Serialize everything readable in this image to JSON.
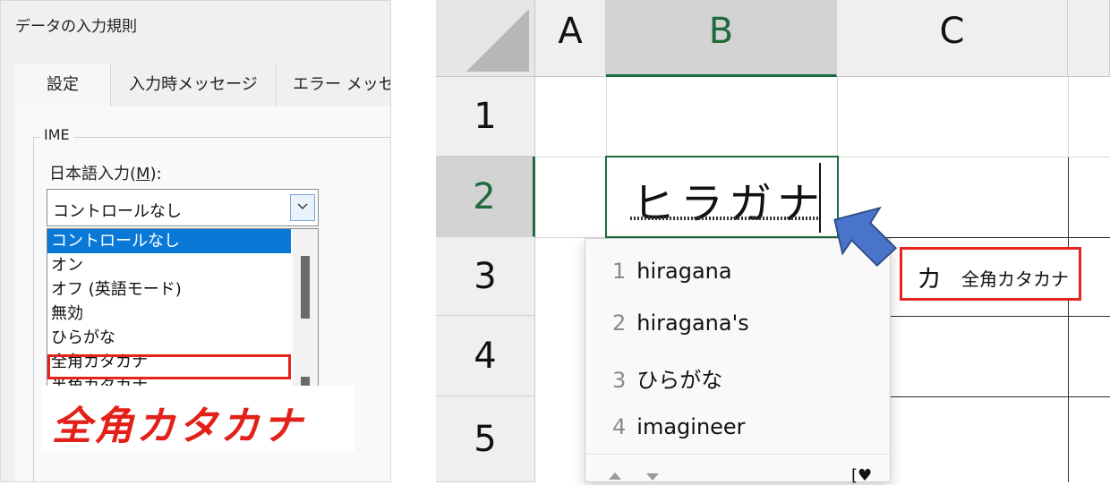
{
  "dialog": {
    "title": "データの入力規則",
    "tabs": [
      "設定",
      "入力時メッセージ",
      "エラー メッセー"
    ],
    "ime_group_label": "IME",
    "jp_input_label_prefix": "日本語入力(",
    "jp_input_label_key": "M",
    "jp_input_label_suffix": "):",
    "select_value": "コントロールなし",
    "options": [
      "コントロールなし",
      "オン",
      "オフ (英語モード)",
      "無効",
      "ひらがな",
      "全角カタカナ",
      "半角カタカナ"
    ],
    "selected_option_index": 0,
    "highlighted_option": "全角カタカナ",
    "big_label": "全角カタカナ"
  },
  "sheet": {
    "columns": [
      "A",
      "B",
      "C"
    ],
    "rows": [
      "1",
      "2",
      "3",
      "4",
      "5"
    ],
    "active_cell_text": "ヒラガナ",
    "ime_candidates": [
      {
        "num": "1",
        "text": "hiragana"
      },
      {
        "num": "2",
        "text": "hiragana's"
      },
      {
        "num": "3",
        "text": "ひらがな"
      },
      {
        "num": "4",
        "text": "imagineer"
      }
    ],
    "ime_mode_char": "カ",
    "ime_mode_text": "全角カタカナ"
  },
  "colors": {
    "accent_green": "#1e6b3c",
    "highlight_red": "#e3241d",
    "selection_blue": "#0a78d7",
    "arrow_blue": "#4a74c9"
  },
  "icons": [
    "chevron-down-icon",
    "pointer-arrow-icon",
    "ime-settings-icon"
  ]
}
